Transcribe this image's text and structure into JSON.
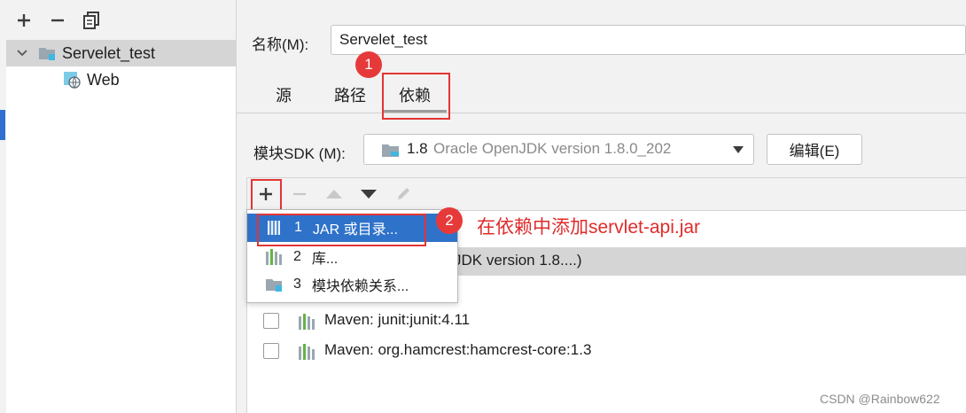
{
  "left_panel": {
    "toolbar": {
      "add_icon": "plus-icon",
      "remove_icon": "minus-icon",
      "copy_icon": "copy-icon"
    },
    "tree": [
      {
        "label": "Servelet_test",
        "icon": "module-folder-icon"
      },
      {
        "label": "Web",
        "icon": "web-facet-icon"
      }
    ]
  },
  "right_panel": {
    "name_label": "名称(M):",
    "name_value": "Servelet_test",
    "tabs": [
      {
        "label": "源"
      },
      {
        "label": "路径"
      },
      {
        "label": "依赖"
      }
    ],
    "sdk_label": "模块SDK (M):",
    "sdk_version": "1.8",
    "sdk_detail": "Oracle OpenJDK version 1.8.0_202",
    "edit_button": "编辑(E)",
    "dep_toolbar": {
      "add_icon": "plus-icon",
      "remove_icon": "minus-icon",
      "up_icon": "arrow-up-icon",
      "down_icon": "arrow-down-icon",
      "edit_icon": "pencil-icon"
    },
    "hidden_row_text": "JDK version 1.8....)",
    "dependencies": [
      {
        "label": "Maven: junit:junit:4.11"
      },
      {
        "label": "Maven: org.hamcrest:hamcrest-core:1.3"
      }
    ]
  },
  "popup_menu": {
    "items": [
      {
        "num": "1",
        "label": "JAR 或目录...",
        "icon": "jar-icon"
      },
      {
        "num": "2",
        "label": "库...",
        "icon": "library-icon"
      },
      {
        "num": "3",
        "label": "模块依赖关系...",
        "icon": "module-icon"
      }
    ]
  },
  "annotations": {
    "badge1": "1",
    "badge2": "2",
    "note": "在依赖中添加servlet-api.jar",
    "colors": {
      "accent_red": "#e23535",
      "selection_blue": "#2f72c9"
    }
  },
  "watermark": "CSDN @Rainbow622"
}
